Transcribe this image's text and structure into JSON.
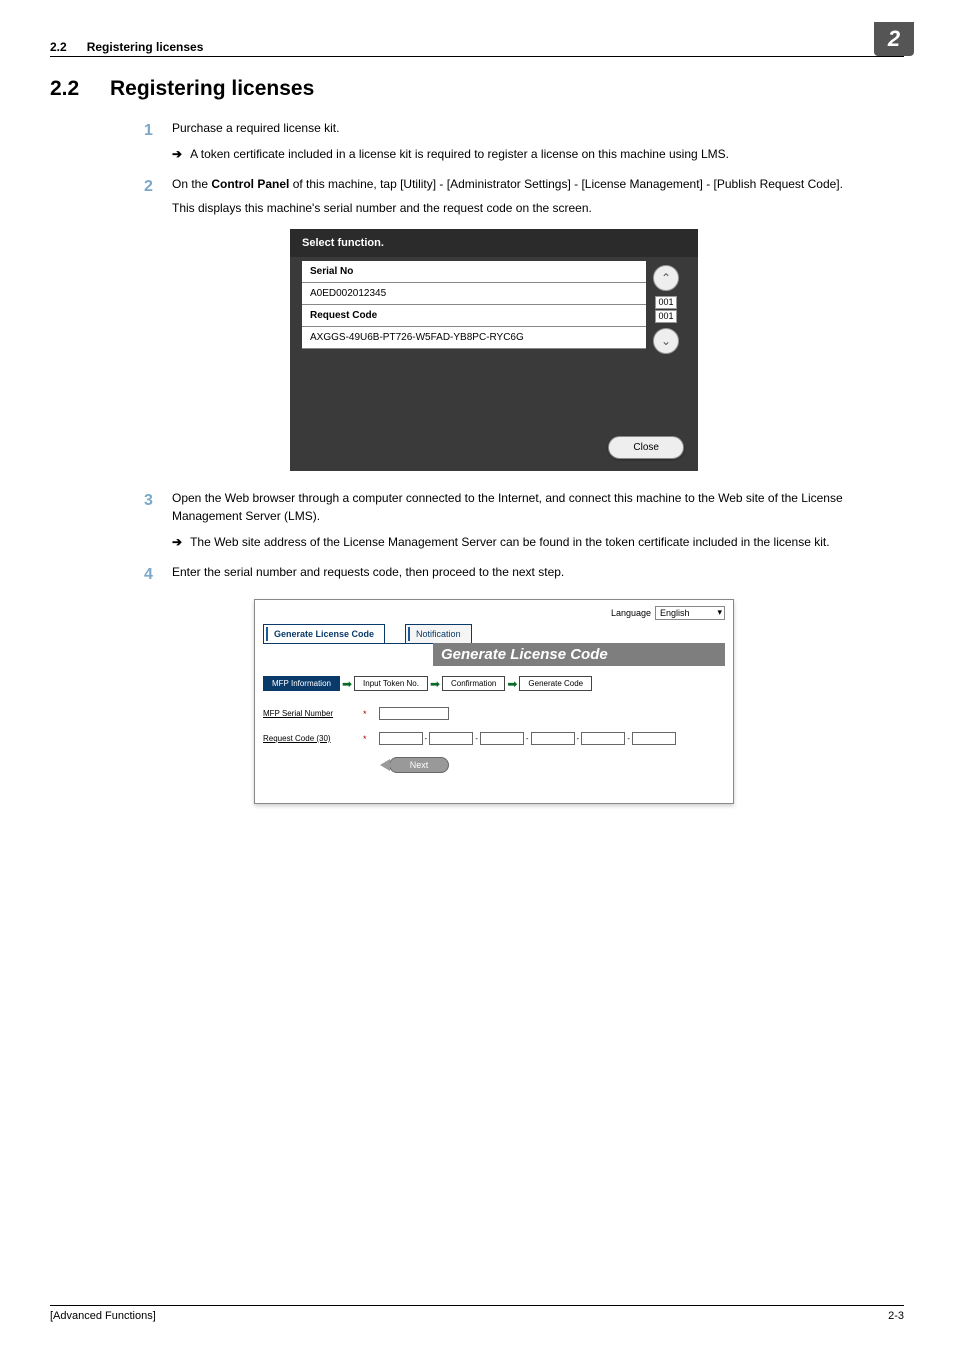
{
  "header": {
    "section_number": "2.2",
    "section_title": "Registering licenses",
    "chapter_badge": "2"
  },
  "heading": {
    "number": "2.2",
    "text": "Registering licenses"
  },
  "steps": {
    "s1": {
      "num": "1",
      "text": "Purchase a required license kit.",
      "sub1": "A token certificate included in a license kit is required to register a license on this machine using LMS."
    },
    "s2": {
      "num": "2",
      "text_pre": "On the ",
      "text_bold": "Control Panel",
      "text_post": " of this machine, tap [Utility] - [Administrator Settings] - [License Management] - [Publish Request Code].",
      "extra": "This displays this machine's serial number and the request code on the screen."
    },
    "s3": {
      "num": "3",
      "text": "Open the Web browser through a computer connected to the Internet, and connect this machine to the Web site of the License Management Server (LMS).",
      "sub1": "The Web site address of the License Management Server can be found in the token certificate included in the license kit."
    },
    "s4": {
      "num": "4",
      "text": "Enter the serial number and requests code, then proceed to the next step."
    }
  },
  "panel1": {
    "title": "Select function.",
    "serial_label": "Serial No",
    "serial_value": "A0ED002012345",
    "request_label": "Request Code",
    "request_value": "AXGGS-49U6B-PT726-W5FAD-YB8PC-RYC6G",
    "page_top": "001",
    "page_bot": "001",
    "close": "Close",
    "up": "⌃",
    "down": "⌄"
  },
  "panel2": {
    "lang_label": "Language",
    "lang_value": "English",
    "tab1": "Generate License Code",
    "tab2": "Notification",
    "banner": "Generate License Code",
    "prog1": "MFP Information",
    "prog2": "Input Token No.",
    "prog3": "Confirmation",
    "prog4": "Generate Code",
    "row1_label": "MFP Serial Number",
    "row2_label": "Request Code (30)",
    "next": "Next"
  },
  "footer": {
    "left": "[Advanced Functions]",
    "right": "2-3"
  },
  "arrows": {
    "sub": "➔"
  }
}
